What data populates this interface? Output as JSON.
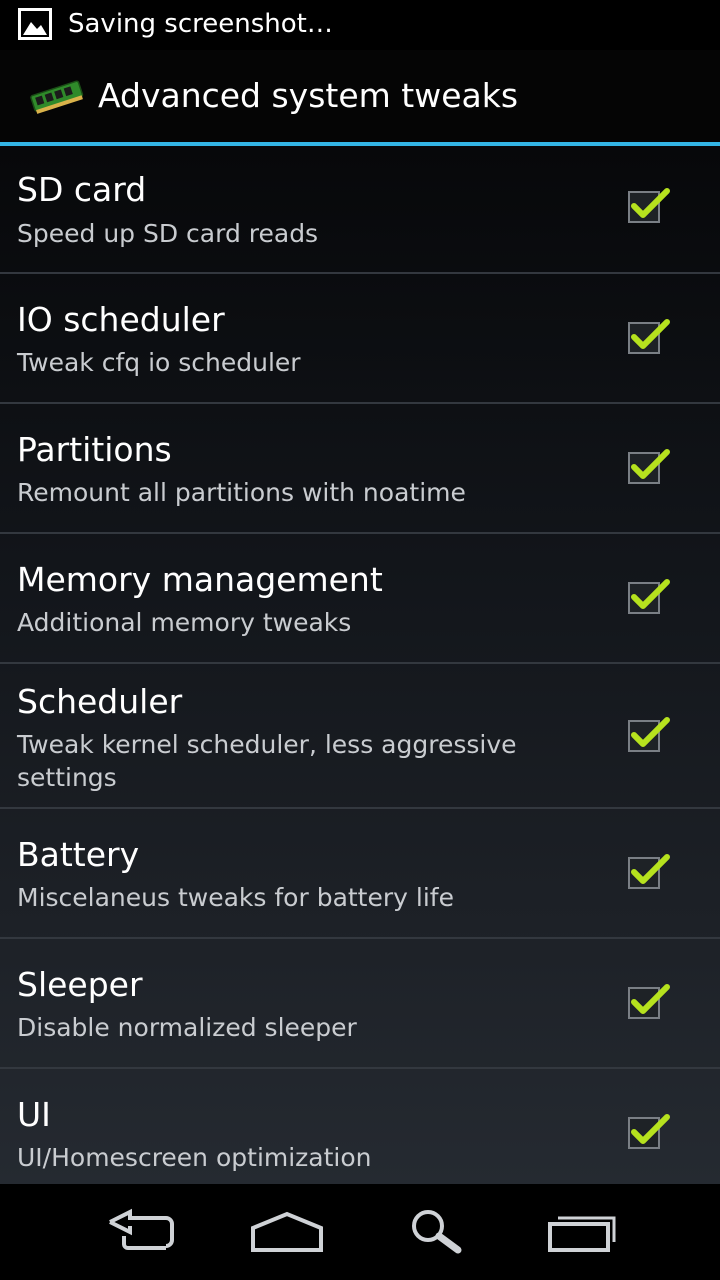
{
  "status_bar": {
    "notification_icon": "image-icon",
    "text": "Saving screenshot…"
  },
  "action_bar": {
    "app_icon": "ram-chip-icon",
    "title": "Advanced system tweaks"
  },
  "colors": {
    "accent": "#33b5e5",
    "check": "#b6e21e"
  },
  "items": [
    {
      "title": "SD card",
      "summary": "Speed up SD card reads",
      "checked": true
    },
    {
      "title": "IO scheduler",
      "summary": "Tweak cfq io scheduler",
      "checked": true
    },
    {
      "title": "Partitions",
      "summary": "Remount all partitions with noatime",
      "checked": true
    },
    {
      "title": "Memory management",
      "summary": "Additional memory tweaks",
      "checked": true
    },
    {
      "title": "Scheduler",
      "summary": "Tweak kernel scheduler, less aggressive settings",
      "checked": true
    },
    {
      "title": "Battery",
      "summary": "Miscelaneus tweaks for battery life",
      "checked": true
    },
    {
      "title": "Sleeper",
      "summary": "Disable normalized sleeper",
      "checked": true
    },
    {
      "title": "UI",
      "summary": "UI/Homescreen optimization",
      "checked": true
    }
  ],
  "nav_bar": {
    "buttons": [
      "back-icon",
      "home-icon",
      "search-icon",
      "recent-apps-icon"
    ]
  }
}
